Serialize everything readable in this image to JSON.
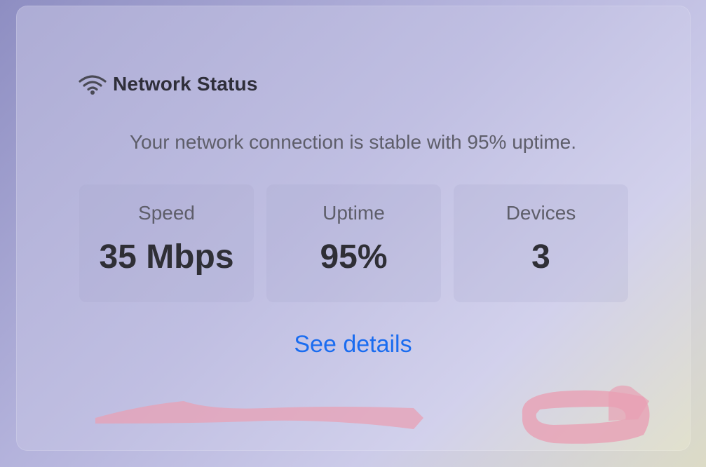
{
  "card": {
    "title": "Network Status",
    "title_icon": "wifi-icon",
    "summary": "Your network connection is stable with 95% uptime.",
    "stats": [
      {
        "label": "Speed",
        "value": "35 Mbps"
      },
      {
        "label": "Uptime",
        "value": "95%"
      },
      {
        "label": "Devices",
        "value": "3"
      }
    ],
    "link_label": "See details"
  },
  "colors": {
    "link": "#1a6cf0",
    "title": "#2f2f3a",
    "annotation": "#e8a0b4"
  }
}
